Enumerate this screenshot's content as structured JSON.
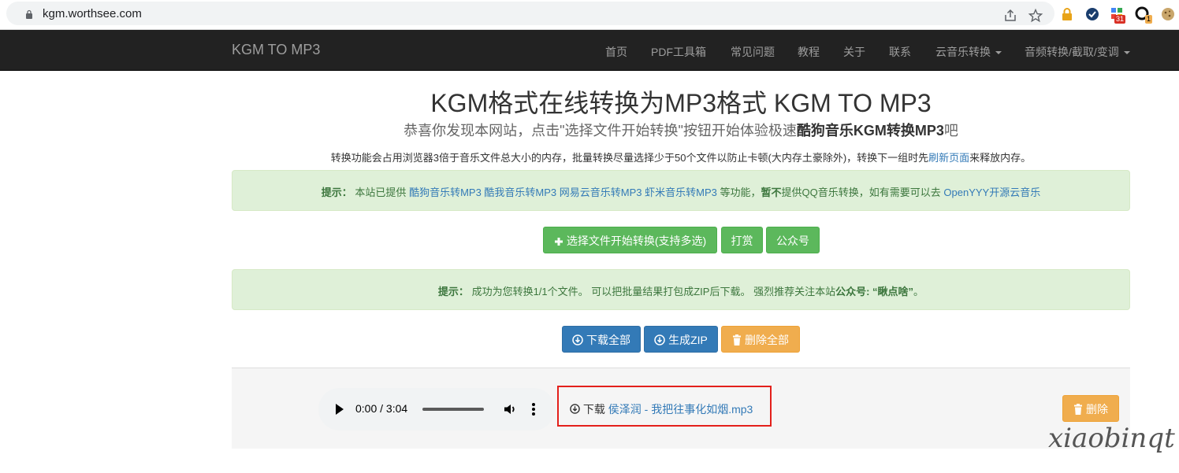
{
  "browser": {
    "url": "kgm.worthsee.com",
    "ext_badge_1": "31",
    "ext_badge_2": "1"
  },
  "navbar": {
    "brand": "KGM TO MP3",
    "items": [
      {
        "label": "首页"
      },
      {
        "label": "PDF工具箱"
      },
      {
        "label": "常见问题"
      },
      {
        "label": "教程"
      },
      {
        "label": "关于"
      },
      {
        "label": "联系"
      },
      {
        "label": "云音乐转换"
      },
      {
        "label": "音频转换/截取/变调"
      }
    ]
  },
  "main": {
    "title": "KGM格式在线转换为MP3格式 KGM TO MP3",
    "subtitle_pre": "恭喜你发现本网站，点击\"选择文件开始转换\"按钮开始体验极速",
    "subtitle_bold": "酷狗音乐KGM转换MP3",
    "subtitle_post": "吧",
    "note_pre": "转换功能会占用浏览器3倍于音乐文件总大小的内存，批量转换尽量选择少于50个文件以防止卡顿(大内存土豪除外)，转换下一组时先",
    "note_link": "刷新页面",
    "note_post": "来释放内存。"
  },
  "alert1": {
    "label": "提示：",
    "text1": "本站已提供",
    "link1": "酷狗音乐转MP3",
    "link2": "酷我音乐转MP3",
    "link3": "网易云音乐转MP3",
    "link4": "虾米音乐转MP3",
    "text2": "等功能，",
    "bold": "暂不",
    "text3": "提供QQ音乐转换，如有需要可以去",
    "link5": "OpenYYY开源云音乐"
  },
  "actions": {
    "select": "选择文件开始转换(支持多选)",
    "reward": "打赏",
    "wechat": "公众号"
  },
  "alert2": {
    "label": "提示：",
    "text": "成功为您转换1/1个文件。 可以把批量结果打包成ZIP后下载。 强烈推荐关注本站",
    "bold": "公众号: “瞅点啥”",
    "end": "。"
  },
  "bulk": {
    "download_all": "下载全部",
    "make_zip": "生成ZIP",
    "delete_all": "删除全部"
  },
  "file": {
    "time": "0:00 / 3:04",
    "download_label": "下载",
    "filename": "侯泽润 - 我把往事化如烟.mp3",
    "delete": "删除"
  },
  "watermark": "xiaobinqt"
}
